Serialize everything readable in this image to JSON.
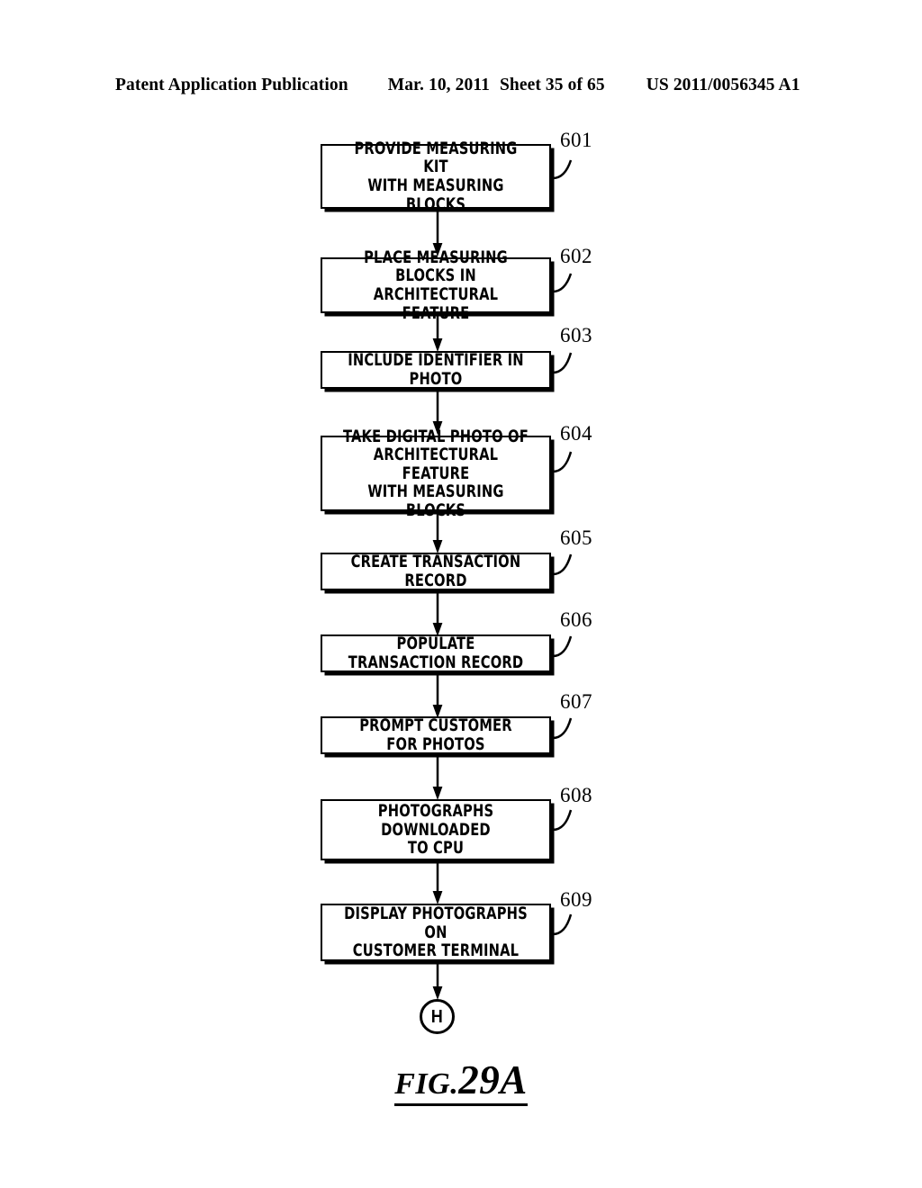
{
  "header": {
    "publication": "Patent Application Publication",
    "date": "Mar. 10, 2011",
    "sheet": "Sheet 35 of 65",
    "patent_number": "US 2011/0056345 A1"
  },
  "figure": {
    "caption_prefix": "FIG.",
    "caption_number": "29A"
  },
  "flowchart": {
    "type": "flowchart",
    "orientation": "vertical",
    "terminal": {
      "label": "H",
      "shape": "circle"
    },
    "steps": [
      {
        "ref": "601",
        "text": "PROVIDE MEASURING KIT\nWITH MEASURING BLOCKS",
        "lines": 2
      },
      {
        "ref": "602",
        "text": "PLACE MEASURING BLOCKS IN\nARCHITECTURAL FEATURE",
        "lines": 2
      },
      {
        "ref": "603",
        "text": "INCLUDE IDENTIFIER IN PHOTO",
        "lines": 1
      },
      {
        "ref": "604",
        "text": "TAKE DIGITAL PHOTO OF\nARCHITECTURAL FEATURE\nWITH MEASURING BLOCKS",
        "lines": 3
      },
      {
        "ref": "605",
        "text": "CREATE TRANSACTION RECORD",
        "lines": 1
      },
      {
        "ref": "606",
        "text": "POPULATE TRANSACTION RECORD",
        "lines": 1
      },
      {
        "ref": "607",
        "text": "PROMPT CUSTOMER FOR PHOTOS",
        "lines": 1
      },
      {
        "ref": "608",
        "text": "PHOTOGRAPHS DOWNLOADED\nTO CPU",
        "lines": 2
      },
      {
        "ref": "609",
        "text": "DISPLAY PHOTOGRAPHS ON\nCUSTOMER TERMINAL",
        "lines": 2
      }
    ]
  },
  "colors": {
    "ink": "#000000",
    "paper": "#ffffff"
  }
}
